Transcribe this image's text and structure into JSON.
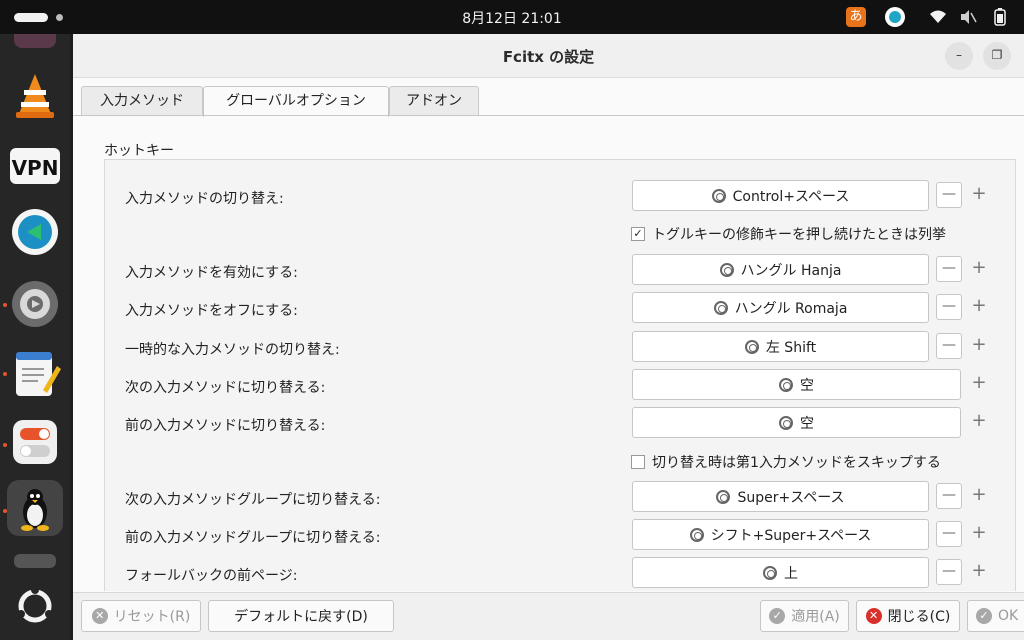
{
  "topbar": {
    "datetime": "8月12日 21:01",
    "ime_indicator": "あ"
  },
  "window": {
    "title": "Fcitx の設定",
    "minimize": "–",
    "maximize": "❐"
  },
  "tabs": [
    "入力メソッド",
    "グローバルオプション",
    "アドオン"
  ],
  "group_label": "ホットキー",
  "rows": {
    "toggle_im": {
      "label": "入力メソッドの切り替え:",
      "value": "Control+スペース"
    },
    "enumerate_check": "トグルキーの修飾キーを押し続けたときは列挙",
    "enable_im": {
      "label": "入力メソッドを有効にする:",
      "value": "ハングル Hanja"
    },
    "disable_im": {
      "label": "入力メソッドをオフにする:",
      "value": "ハングル Romaja"
    },
    "temp_toggle": {
      "label": "一時的な入力メソッドの切り替え:",
      "value": "左 Shift"
    },
    "next_im": {
      "label": "次の入力メソッドに切り替える:",
      "value": "空"
    },
    "prev_im": {
      "label": "前の入力メソッドに切り替える:",
      "value": "空"
    },
    "skip_check": "切り替え時は第1入力メソッドをスキップする",
    "next_group": {
      "label": "次の入力メソッドグループに切り替える:",
      "value": "Super+スペース"
    },
    "prev_group": {
      "label": "前の入力メソッドグループに切り替える:",
      "value": "シフト+Super+スペース"
    },
    "fallback_prev": {
      "label": "フォールバックの前ページ:",
      "value": "上"
    }
  },
  "buttons": {
    "reset": "リセット(R)",
    "defaults": "デフォルトに戻す(D)",
    "apply": "適用(A)",
    "close": "閉じる(C)",
    "ok": "OK"
  },
  "common": {
    "minus": "—",
    "plus": "+"
  },
  "colors": {
    "accent": "#e8542a",
    "close_icon": "#d9302c",
    "apply_icon": "#a8a8a8"
  }
}
